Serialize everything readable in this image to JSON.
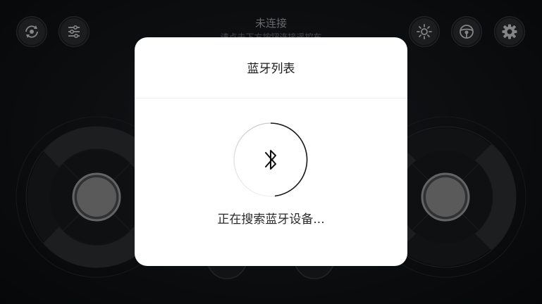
{
  "header": {
    "status_title": "未连接",
    "status_subtitle": "请点击下方按钮连接遥控车"
  },
  "toolbar_left": [
    {
      "icon": "rotate-icon"
    },
    {
      "icon": "sliders-icon"
    }
  ],
  "toolbar_right": [
    {
      "icon": "brightness-icon"
    },
    {
      "icon": "steering-wheel-icon"
    },
    {
      "icon": "gear-icon"
    }
  ],
  "dialog": {
    "title": "蓝牙列表",
    "icon": "bluetooth-icon",
    "status": "正在搜索蓝牙设备..."
  },
  "colors": {
    "background": "#131518",
    "dialog_bg": "#ffffff",
    "joystick_knob": "#8a8a8a"
  }
}
